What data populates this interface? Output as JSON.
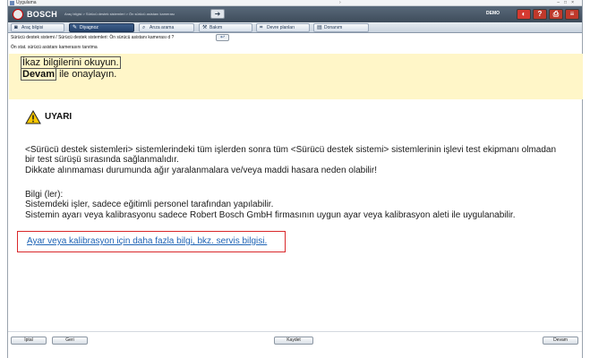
{
  "window": {
    "title": "Uygulama"
  },
  "header": {
    "brand": "BOSCH",
    "path": "Araç bilgisi > Sürücü destek sistemleri > Ön sürücü asistanı kamerası",
    "forward_glyph": "➜",
    "demo_label": "DEMO",
    "buttons": [
      {
        "name": "car-button",
        "glyph": "◐",
        "color": "#d63a30"
      },
      {
        "name": "help-button",
        "glyph": "?",
        "color": "#c0392b"
      },
      {
        "name": "print-button",
        "glyph": "⎙",
        "color": "#c0392b"
      },
      {
        "name": "menu-button",
        "glyph": "≡",
        "color": "#c0392b"
      }
    ]
  },
  "tabs": [
    {
      "label": "Araç bilgisi",
      "icon": "car-icon",
      "glyph": "◙"
    },
    {
      "label": "Diyagnoz",
      "icon": "stethoscope-icon",
      "glyph": "✎"
    },
    {
      "label": "Arıza arama",
      "icon": "search-icon",
      "glyph": "⌕"
    },
    {
      "label": "Bakım",
      "icon": "wrench-icon",
      "glyph": "⚒"
    },
    {
      "label": "Devre planları",
      "icon": "circuit-icon",
      "glyph": "⌗"
    },
    {
      "label": "Donanım",
      "icon": "equipment-icon",
      "glyph": "▤"
    }
  ],
  "breadcrumb": "Sürücü destek sistemi / Sürücü destek sistemleri: Ön sürücü asistanı kamerası d ?",
  "breadcrumb_back": "↩",
  "step_title": "Ön stat. sürücü asistanı kamerasını tanıtma",
  "instructions": {
    "line1": "İkaz bilgilerini okuyun.",
    "continue_key": "Devam",
    "line2_suffix": " ile onaylayın."
  },
  "warning": {
    "title": "UYARI",
    "paragraph_lines": [
      "<Sürücü destek sistemleri> sistemlerindeki tüm işlerden sonra tüm <Sürücü destek sistemi> sistemlerinin işlevi test ekipmanı olmadan",
      "bir test sürüşü sırasında sağlanmalıdır.",
      "Dikkate alınmaması durumunda ağır yaralanmalara ve/veya maddi hasara neden olabilir!"
    ],
    "info_label": "Bilgi (ler):",
    "info_lines": [
      "Sistemdeki işler, sadece eğitimli personel tarafından yapılabilir.",
      "Sistemin ayarı veya kalibrasyonu sadece Robert Bosch GmbH firmasının uygun ayar veya kalibrasyon aleti ile uygulanabilir."
    ]
  },
  "link_text": "Ayar veya kalibrasyon için daha fazla bilgi, bkz. servis bilgisi.",
  "bottom_buttons": {
    "left1": "İptal",
    "left2": "Geri",
    "center": "Kaydet",
    "right": "Devam"
  }
}
